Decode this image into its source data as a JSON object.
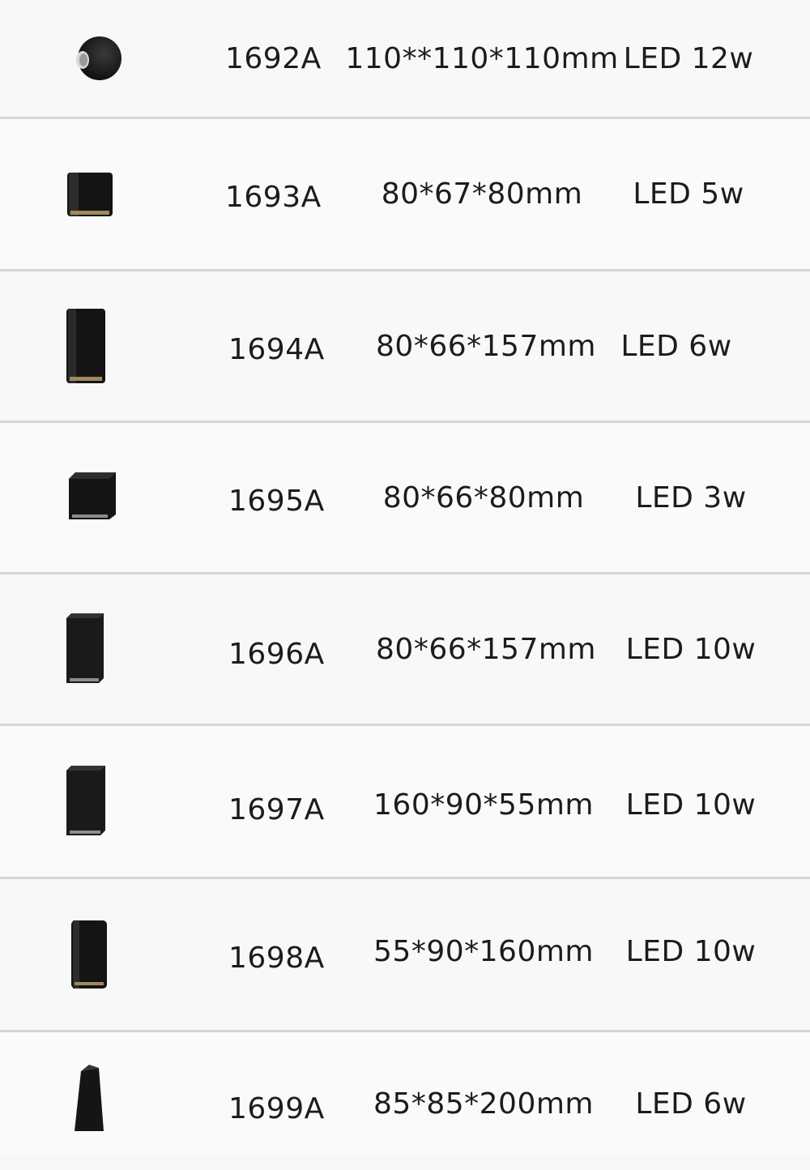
{
  "products": [
    {
      "model": "1692A",
      "dimensions": "110**110*110mm",
      "power": "LED 12w",
      "icon": "round-spot-light-icon"
    },
    {
      "model": "1693A",
      "dimensions": "80*67*80mm",
      "power": "LED 5w",
      "icon": "short-cylinder-light-icon"
    },
    {
      "model": "1694A",
      "dimensions": "80*66*157mm",
      "power": "LED 6w",
      "icon": "tall-cylinder-light-icon"
    },
    {
      "model": "1695A",
      "dimensions": "80*66*80mm",
      "power": "LED 3w",
      "icon": "square-cube-light-icon"
    },
    {
      "model": "1696A",
      "dimensions": "80*66*157mm",
      "power": "LED 10w",
      "icon": "tall-square-light-icon"
    },
    {
      "model": "1697A",
      "dimensions": "160*90*55mm",
      "power": "LED 10w",
      "icon": "tall-square-light-icon"
    },
    {
      "model": "1698A",
      "dimensions": "55*90*160mm",
      "power": "LED 10w",
      "icon": "tall-rounded-light-icon"
    },
    {
      "model": "1699A",
      "dimensions": "85*85*200mm",
      "power": "LED 6w",
      "icon": "tapered-wedge-light-icon"
    }
  ]
}
